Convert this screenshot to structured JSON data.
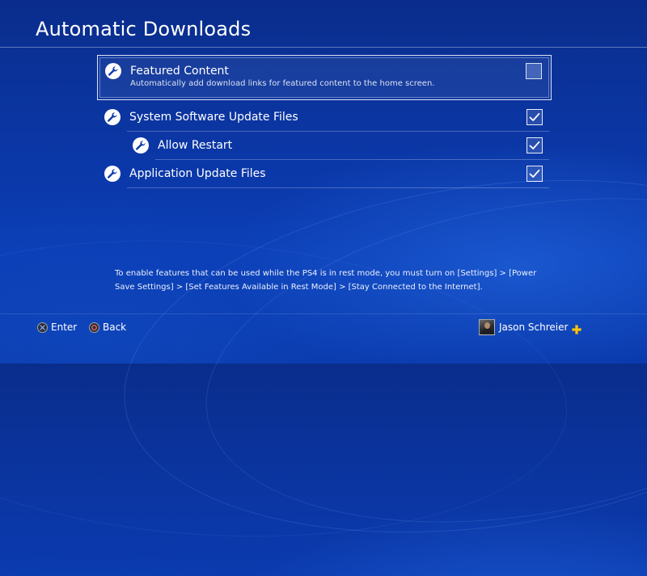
{
  "page": {
    "title": "Automatic Downloads"
  },
  "settings": [
    {
      "label": "Featured Content",
      "description": "Automatically add download links for featured content to the home screen.",
      "checked": false,
      "icon": "wrench-icon",
      "indent": false,
      "focused": true
    },
    {
      "label": "System Software Update Files",
      "checked": true,
      "icon": "wrench-icon",
      "indent": false
    },
    {
      "label": "Allow Restart",
      "checked": true,
      "icon": "wrench-icon",
      "indent": true
    },
    {
      "label": "Application Update Files",
      "checked": true,
      "icon": "wrench-icon",
      "indent": false
    }
  ],
  "note": {
    "text": "To enable features that can be used while the PS4 is in rest mode, you must turn on [Settings] > [Power Save Settings] > [Set Features Available in Rest Mode] > [Stay Connected to the Internet]."
  },
  "footer": {
    "enter_label": "Enter",
    "enter_icon": "cross-button-icon",
    "back_label": "Back",
    "back_icon": "circle-button-icon",
    "user_name": "Jason Schreier",
    "plus_icon": "playstation-plus-icon"
  },
  "colors": {
    "background": "#0b38a8",
    "plus_yellow": "#f5c518"
  }
}
